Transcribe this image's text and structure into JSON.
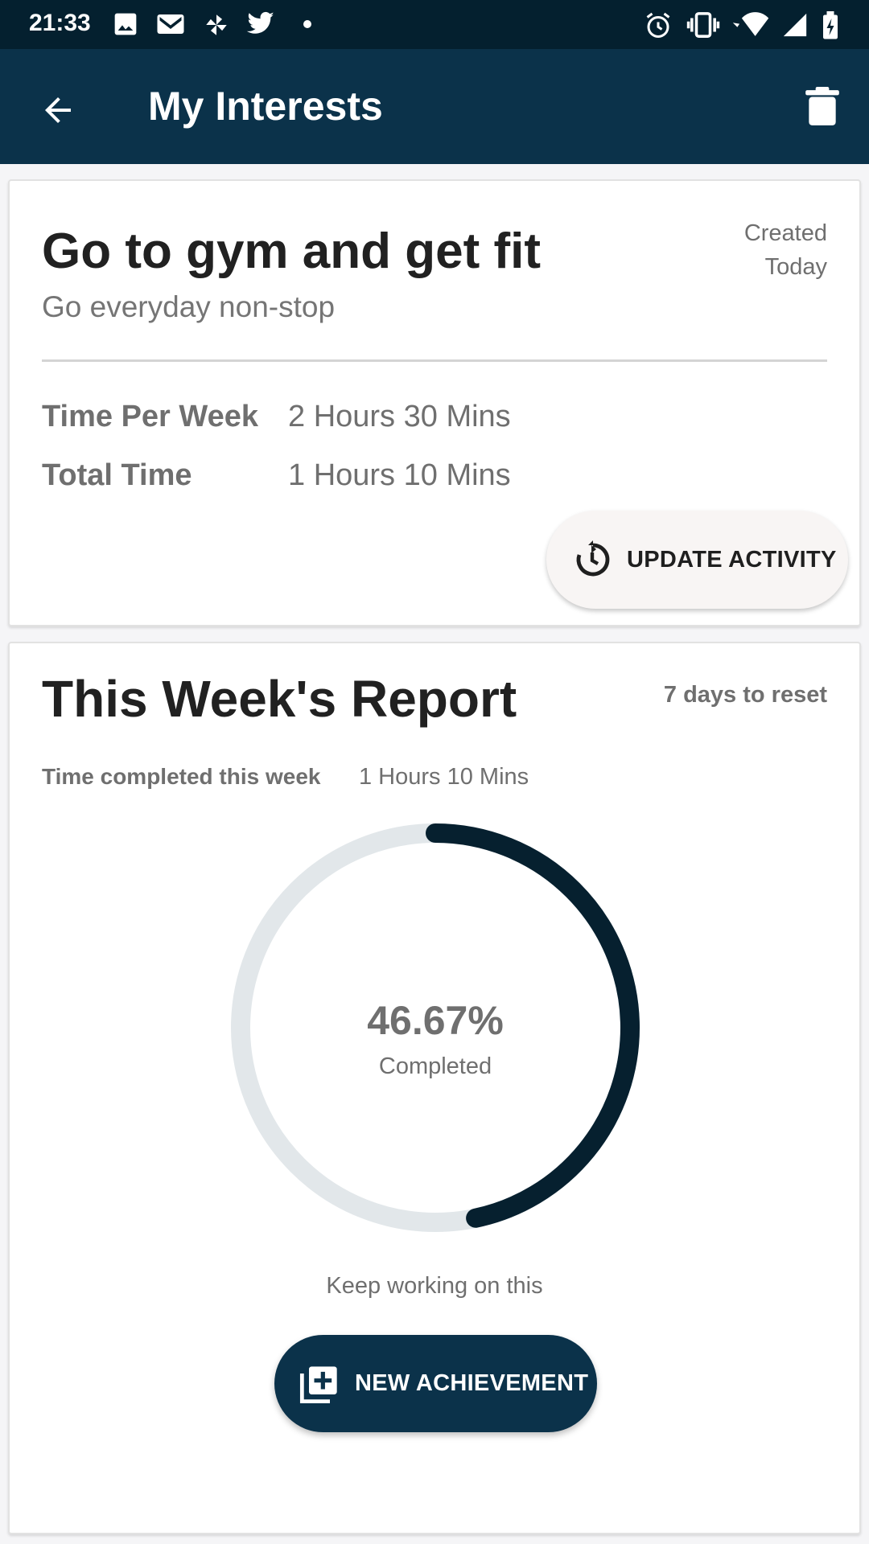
{
  "status_bar": {
    "time": "21:33",
    "left_icons": [
      "image-icon",
      "gmail-icon",
      "pinwheel-icon",
      "twitter-icon",
      "dot-icon"
    ],
    "right_icons": [
      "alarm-icon",
      "vibrate-icon",
      "wifi-icon",
      "signal-icon",
      "battery-icon"
    ]
  },
  "app_bar": {
    "title": "My Interests",
    "back_icon": "back-arrow-icon",
    "delete_icon": "trash-icon",
    "background": "#0b324a"
  },
  "goal_card": {
    "title": "Go to gym and get fit",
    "subtitle": "Go everyday non-stop",
    "created_label": "Created",
    "created_value": "Today",
    "rows": [
      {
        "label": "Time Per Week",
        "value": "2 Hours 30 Mins"
      },
      {
        "label": "Total Time",
        "value": "1 Hours 10 Mins"
      }
    ],
    "update_button": {
      "label": "UPDATE ACTIVITY",
      "icon": "history-icon"
    }
  },
  "report_card": {
    "title": "This Week's Report",
    "reset_text": "7 days to reset",
    "time_label": "Time completed this week",
    "time_value": "1 Hours 10 Mins",
    "progress": {
      "fraction": 0.4667,
      "percent_text": "46.67%",
      "label": "Completed",
      "track_color": "#e2e7ea",
      "fill_color": "#06202f"
    },
    "encouragement": "Keep working on this",
    "new_button": {
      "label": "NEW ACHIEVEMENT",
      "icon": "add-box-icon"
    }
  }
}
